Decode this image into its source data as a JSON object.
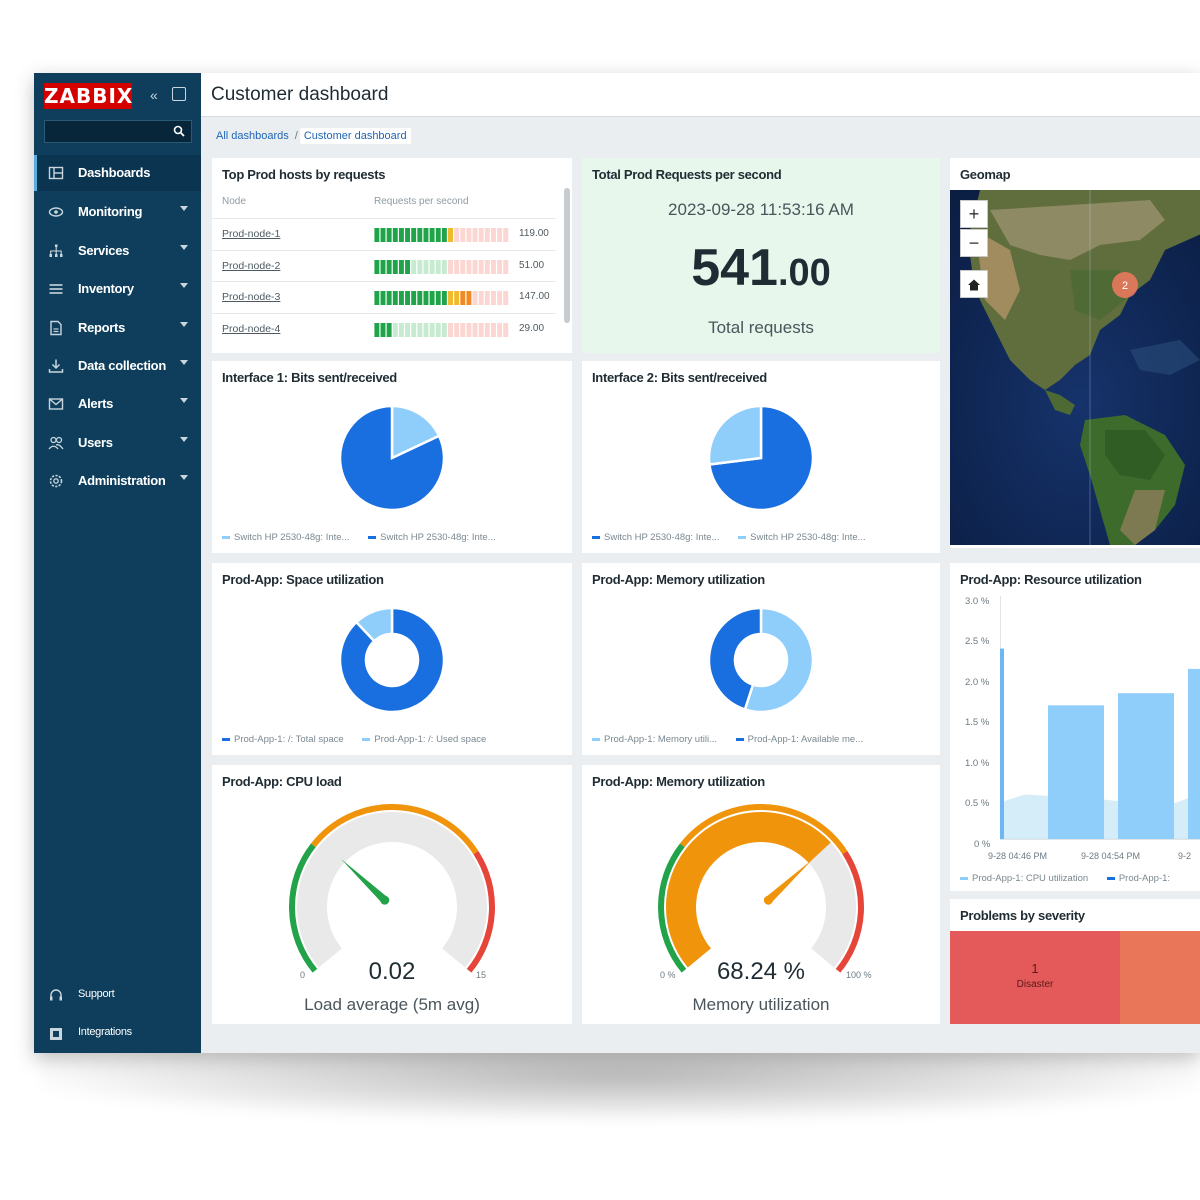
{
  "app": {
    "logo": "ZABBIX",
    "page_title": "Customer dashboard",
    "accent": "#d40000",
    "sidebar_bg": "#0e3e5b"
  },
  "breadcrumb": [
    {
      "label": "All dashboards"
    },
    {
      "label": "Customer dashboard"
    }
  ],
  "breadcrumb_separator": "/",
  "sidebar": {
    "items": [
      {
        "label": "Dashboards",
        "icon": "dashboard-icon",
        "active": true
      },
      {
        "label": "Monitoring",
        "icon": "eye-icon"
      },
      {
        "label": "Services",
        "icon": "services-icon"
      },
      {
        "label": "Inventory",
        "icon": "list-icon"
      },
      {
        "label": "Reports",
        "icon": "report-icon"
      },
      {
        "label": "Data collection",
        "icon": "download-icon"
      },
      {
        "label": "Alerts",
        "icon": "mail-icon"
      },
      {
        "label": "Users",
        "icon": "users-icon"
      },
      {
        "label": "Administration",
        "icon": "gear-icon"
      }
    ],
    "bottom": [
      {
        "label": "Support",
        "icon": "support-icon"
      },
      {
        "label": "Integrations",
        "icon": "integrations-icon"
      }
    ]
  },
  "widgets": {
    "top_hosts": {
      "title": "Top Prod hosts by requests",
      "columns": [
        "Node",
        "Requests per second"
      ],
      "rows": [
        {
          "node": "Prod-node-1",
          "value": "119.00",
          "num": 119
        },
        {
          "node": "Prod-node-2",
          "value": "51.00",
          "num": 51
        },
        {
          "node": "Prod-node-3",
          "value": "147.00",
          "num": 147
        },
        {
          "node": "Prod-node-4",
          "value": "29.00",
          "num": 29
        }
      ]
    },
    "item_value": {
      "title": "Total Prod Requests per second",
      "timestamp": "2023-09-28 11:53:16 AM",
      "value_int": "541",
      "value_dec": ".00",
      "description": "Total requests"
    },
    "geomap": {
      "title": "Geomap",
      "zoom_in": "+",
      "zoom_out": "−",
      "cluster_count": "2"
    },
    "pie1": {
      "title": "Interface 1: Bits sent/received",
      "legend": [
        {
          "label": "Switch HP 2530-48g: Inte...",
          "color": "#8fcdfb"
        },
        {
          "label": "Switch HP 2530-48g: Inte...",
          "color": "#1a6fe0"
        }
      ]
    },
    "pie2": {
      "title": "Interface 2: Bits sent/received",
      "legend": [
        {
          "label": "Switch HP 2530-48g: Inte...",
          "color": "#1a6fe0"
        },
        {
          "label": "Switch HP 2530-48g: Inte...",
          "color": "#8fcdfb"
        }
      ]
    },
    "donut1": {
      "title": "Prod-App: Space utilization",
      "legend": [
        {
          "label": "Prod-App-1: /: Total space",
          "color": "#1a6fe0"
        },
        {
          "label": "Prod-App-1: /: Used space",
          "color": "#8fcdfb"
        }
      ]
    },
    "donut2": {
      "title": "Prod-App: Memory utilization",
      "legend": [
        {
          "label": "Prod-App-1: Memory utili...",
          "color": "#8fcdfb"
        },
        {
          "label": "Prod-App-1: Available me...",
          "color": "#1a6fe0"
        }
      ]
    },
    "cpu_gauge": {
      "title": "Prod-App: CPU load",
      "value": "0.02",
      "num": 0.02,
      "min": "0",
      "max": "15",
      "min_num": 0,
      "max_num": 15,
      "description": "Load average (5m avg)"
    },
    "mem_gauge": {
      "title": "Prod-App: Memory utilization",
      "value": "68.24 %",
      "num": 68.24,
      "min": "0 %",
      "max": "100 %",
      "min_num": 0,
      "max_num": 100,
      "description": "Memory utilization"
    },
    "resource": {
      "title": "Prod-App: Resource utilization",
      "yticks": [
        "3.0 %",
        "2.5 %",
        "2.0 %",
        "1.5 %",
        "1.0 %",
        "0.5 %",
        "0 %"
      ],
      "xticks": [
        "9-28 04:46 PM",
        "9-28 04:54 PM",
        "9-2"
      ],
      "legend": [
        {
          "label": "Prod-App-1: CPU utilization",
          "color": "#8fcdfb"
        },
        {
          "label": "Prod-App-1:",
          "color": "#1a6fe0"
        }
      ]
    },
    "problems": {
      "title": "Problems by severity",
      "severities": [
        {
          "count": "1",
          "label": "Disaster",
          "color": "#e45959"
        },
        {
          "count": "",
          "label": "",
          "color": "#e97659"
        }
      ]
    }
  },
  "chart_data": [
    {
      "type": "pie",
      "title": "Interface 1: Bits sent/received",
      "slices": [
        {
          "name": "Switch HP 2530-48g: Inte...",
          "value": 18,
          "color": "#8fcdfb"
        },
        {
          "name": "Switch HP 2530-48g: Inte...",
          "value": 82,
          "color": "#1a6fe0"
        }
      ]
    },
    {
      "type": "pie",
      "title": "Interface 2: Bits sent/received",
      "slices": [
        {
          "name": "Switch HP 2530-48g: Inte...",
          "value": 73,
          "color": "#1a6fe0"
        },
        {
          "name": "Switch HP 2530-48g: Inte...",
          "value": 27,
          "color": "#8fcdfb"
        }
      ]
    },
    {
      "type": "pie",
      "title": "Prod-App: Space utilization",
      "donut": true,
      "slices": [
        {
          "name": "Prod-App-1: /: Total space",
          "value": 88,
          "color": "#1a6fe0"
        },
        {
          "name": "Prod-App-1: /: Used space",
          "value": 12,
          "color": "#8fcdfb"
        }
      ]
    },
    {
      "type": "pie",
      "title": "Prod-App: Memory utilization",
      "donut": true,
      "slices": [
        {
          "name": "Prod-App-1: Memory utili...",
          "value": 55,
          "color": "#8fcdfb"
        },
        {
          "name": "Prod-App-1: Available me...",
          "value": 45,
          "color": "#1a6fe0"
        }
      ]
    },
    {
      "type": "bar",
      "title": "Prod-App: Resource utilization",
      "ylim": [
        0,
        3.0
      ],
      "series": [
        {
          "name": "Prod-App-1: CPU utilization",
          "values": [
            2.35,
            1.65,
            1.8,
            2.1
          ]
        }
      ]
    }
  ]
}
